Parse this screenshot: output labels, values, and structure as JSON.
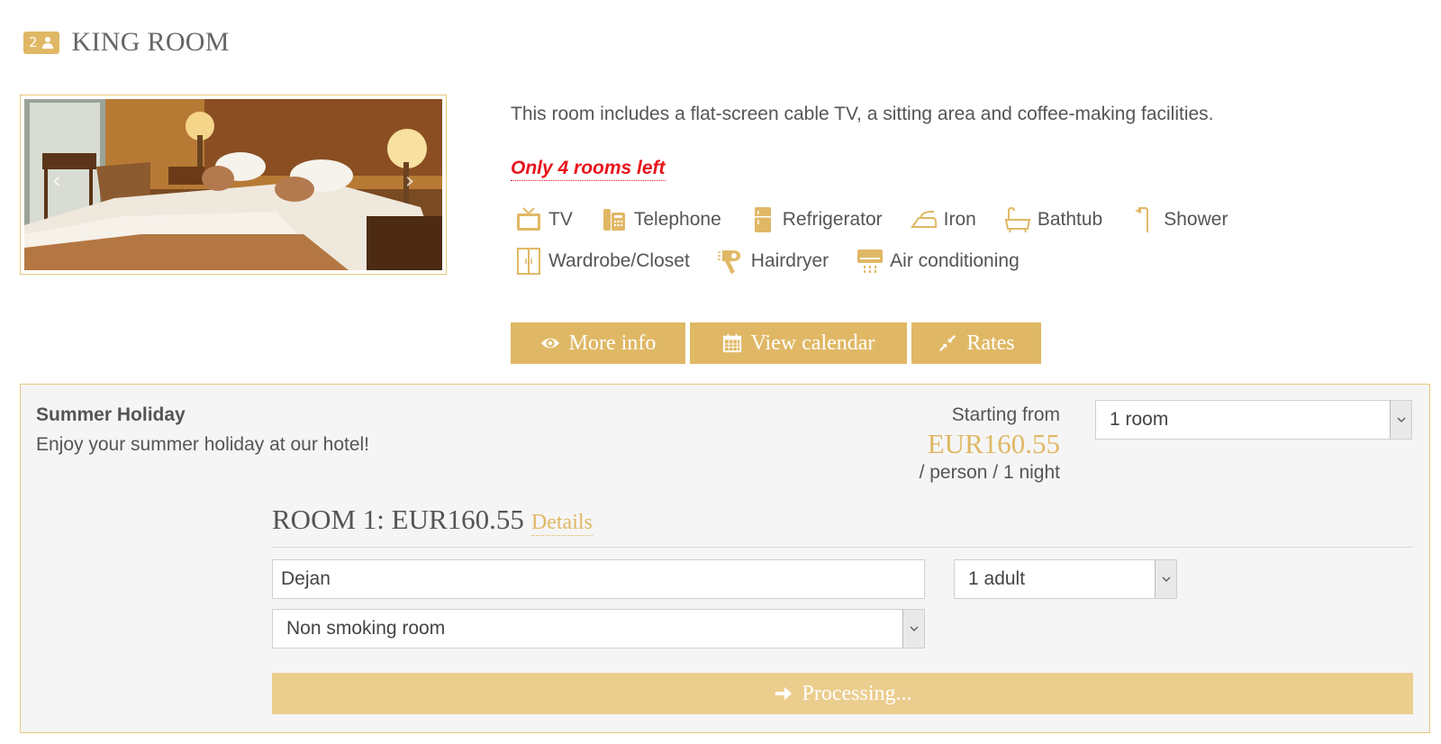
{
  "room": {
    "occupancy": "2",
    "title": "KING ROOM",
    "description": "This room includes a flat-screen cable TV, a sitting area and coffee-making facilities.",
    "availability": "Only 4 rooms left",
    "amenities": [
      {
        "label": "TV",
        "icon": "tv-icon"
      },
      {
        "label": "Telephone",
        "icon": "telephone-icon"
      },
      {
        "label": "Refrigerator",
        "icon": "refrigerator-icon"
      },
      {
        "label": "Iron",
        "icon": "iron-icon"
      },
      {
        "label": "Bathtub",
        "icon": "bathtub-icon"
      },
      {
        "label": "Shower",
        "icon": "shower-icon"
      },
      {
        "label": "Wardrobe/Closet",
        "icon": "wardrobe-icon"
      },
      {
        "label": "Hairdryer",
        "icon": "hairdryer-icon"
      },
      {
        "label": "Air conditioning",
        "icon": "air-conditioning-icon"
      }
    ],
    "buttons": {
      "more_info": "More info",
      "view_calendar": "View calendar",
      "rates": "Rates"
    }
  },
  "rate": {
    "name": "Summer Holiday",
    "description": "Enjoy your summer holiday at our hotel!",
    "starting_label": "Starting from",
    "starting_price": "EUR160.55",
    "starting_unit": "/ person / 1 night",
    "rooms_selected": "1 room",
    "room_line_title": "ROOM 1: EUR160.55",
    "details_link": "Details",
    "guest_name": "Dejan",
    "adults_selected": "1 adult",
    "smoking_selected": "Non smoking room",
    "processing_label": "Processing..."
  },
  "colors": {
    "accent": "#e0b865",
    "accent_light": "#ebcd8d",
    "alert": "#e8141c",
    "panel_bg": "#f5f5f5"
  }
}
